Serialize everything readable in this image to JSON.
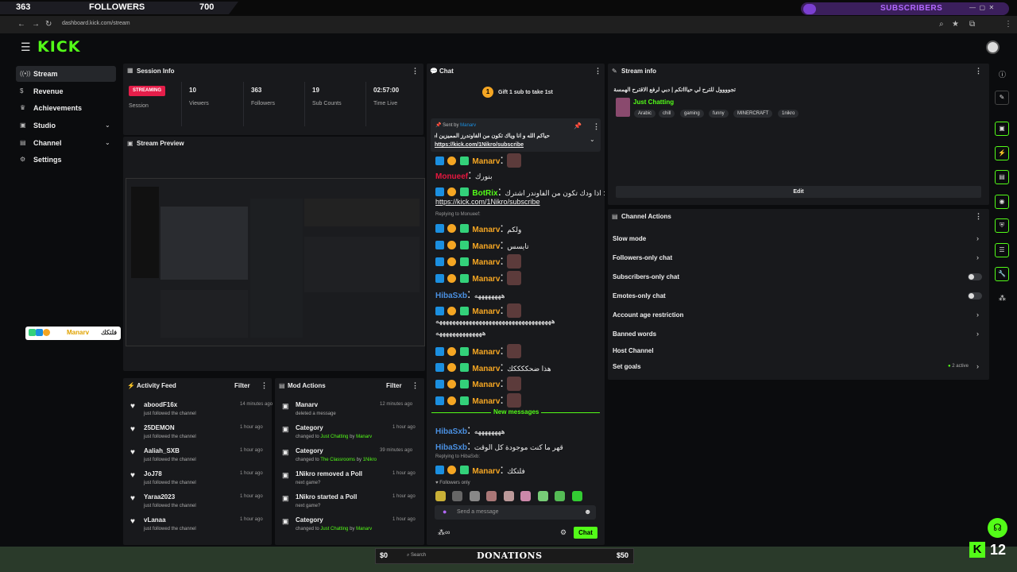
{
  "overlay": {
    "left_count": "363",
    "left_label": "FOLLOWERS",
    "left_goal": "700",
    "right_label": "SUBSCRIBERS"
  },
  "browser": {
    "url": "dashboard.kick.com/stream"
  },
  "header": {
    "logo": "KICK"
  },
  "sidebar": {
    "items": [
      {
        "label": "Stream"
      },
      {
        "label": "Revenue"
      },
      {
        "label": "Achievements"
      },
      {
        "label": "Studio"
      },
      {
        "label": "Channel"
      },
      {
        "label": "Settings"
      }
    ]
  },
  "session": {
    "title": "Session Info",
    "status": "STREAMING",
    "status_label": "Session",
    "stats": [
      {
        "value": "10",
        "label": "Viewers"
      },
      {
        "value": "363",
        "label": "Followers"
      },
      {
        "value": "19",
        "label": "Sub Counts"
      },
      {
        "value": "02:57:00",
        "label": "Time Live"
      }
    ]
  },
  "preview": {
    "title": "Stream Preview"
  },
  "activity": {
    "title": "Activity Feed",
    "filter": "Filter",
    "items": [
      {
        "name": "aboodF16x",
        "sub": "just followed the channel",
        "time": "14 minutes ago"
      },
      {
        "name": "25DEMON",
        "sub": "just followed the channel",
        "time": "1 hour ago"
      },
      {
        "name": "Aaliah_SXB",
        "sub": "just followed the channel",
        "time": "1 hour ago"
      },
      {
        "name": "JoJ78",
        "sub": "just followed the channel",
        "time": "1 hour ago"
      },
      {
        "name": "Yaraa2023",
        "sub": "just followed the channel",
        "time": "1 hour ago"
      },
      {
        "name": "vLanaa",
        "sub": "just followed the channel",
        "time": "1 hour ago"
      }
    ]
  },
  "mod": {
    "title": "Mod Actions",
    "filter": "Filter",
    "items": [
      {
        "name": "Manarv",
        "sub_pre": "deleted a message",
        "sub_hl": "",
        "sub_by": "",
        "sub_user": "",
        "time": "12 minutes ago"
      },
      {
        "name": "Category",
        "sub_pre": "changed to",
        "sub_hl": "Just Chatting",
        "sub_by": "by",
        "sub_user": "Manarv",
        "time": "1 hour ago"
      },
      {
        "name": "Category",
        "sub_pre": "changed to",
        "sub_hl": "The Classrooms",
        "sub_by": "by",
        "sub_user": "1Nikro",
        "time": "39 minutes ago"
      },
      {
        "name": "1Nikro removed a Poll",
        "sub_pre": "next game?",
        "sub_hl": "",
        "sub_by": "",
        "sub_user": "",
        "time": "1 hour ago"
      },
      {
        "name": "1Nikro started a Poll",
        "sub_pre": "next game?",
        "sub_hl": "",
        "sub_by": "",
        "sub_user": "",
        "time": "1 hour ago"
      },
      {
        "name": "Category",
        "sub_pre": "changed to",
        "sub_hl": "Just Chatting",
        "sub_by": "by",
        "sub_user": "Manarv",
        "time": "1 hour ago"
      }
    ]
  },
  "chat": {
    "title": "Chat",
    "gift_text": "Gift 1 sub to take 1st",
    "pinned_sender": "Sent by",
    "pinned_user": "Manarv",
    "pinned_text": "حياكم الله و انا وياك تكون من الفاوندرز المميزين اشتراكك",
    "pinned_link": "https://kick.com/1Nikro/subscribe",
    "messages": [
      {
        "user": "Manarv",
        "text": ""
      },
      {
        "user": "Monueef",
        "text": "بنورك"
      },
      {
        "user": "BotRix",
        "text": "اذا ودك تكون من الفاوندر اشترك :"
      },
      {
        "user": "",
        "text": "https://kick.com/1Nikro/subscribe"
      },
      {
        "user": "",
        "text": "Replying to Monueef:"
      },
      {
        "user": "Manarv",
        "text": "ولكم"
      },
      {
        "user": "Manarv",
        "text": "تايسس"
      },
      {
        "user": "Manarv",
        "text": ""
      },
      {
        "user": "Manarv",
        "text": ""
      },
      {
        "user": "HibaSxb",
        "text": "ههههههههه"
      },
      {
        "user": "Manarv",
        "text": ""
      },
      {
        "user": "",
        "text": "هههههههههههههههههههههههههههههههههههه"
      },
      {
        "user": "",
        "text": "ههههههههههههههه"
      },
      {
        "user": "Manarv",
        "text": ""
      },
      {
        "user": "Manarv",
        "text": "هذا ضحككككك"
      },
      {
        "user": "Manarv",
        "text": ""
      },
      {
        "user": "Manarv",
        "text": ""
      },
      {
        "user": "HibaSxb",
        "text": "ههههههههه"
      },
      {
        "user": "HibaSxb",
        "text": "قهر ما كنت موجودة كل الوقت"
      },
      {
        "user": "",
        "text": "Replying to HibaSxb:"
      },
      {
        "user": "Manarv",
        "text": "فلتكك"
      }
    ],
    "new_messages": "New messages",
    "followers_only": "Followers only",
    "input_placeholder": "Send a message",
    "send_label": "Chat"
  },
  "stream_info": {
    "title": "Stream info",
    "stream_title": "تجوووول للترح لي حياااتكم | دبي لرفع الاقترح الهمسة",
    "category": "Just Chatting",
    "tags": [
      "Arabic",
      "chill",
      "gaming",
      "funny",
      "MINERCRAFT",
      "1nikro"
    ],
    "edit_label": "Edit"
  },
  "channel_actions": {
    "title": "Channel Actions",
    "items": [
      {
        "label": "Slow mode"
      },
      {
        "label": "Followers-only chat"
      },
      {
        "label": "Subscribers-only chat"
      },
      {
        "label": "Emotes-only chat"
      },
      {
        "label": "Account age restriction"
      },
      {
        "label": "Banned words"
      },
      {
        "label": "Host Channel"
      },
      {
        "label": "Set goals"
      }
    ],
    "goals_active": "2 active"
  },
  "overlay_chat": {
    "user": "Manarv",
    "text": "فلتكك"
  },
  "taskbar": {
    "left_amount": "$0",
    "search": "Search",
    "donations": "DONATIONS",
    "right_amount": "$50",
    "kick_count": "12"
  },
  "colors": {
    "accent": "#53fc18",
    "live": "#e51e4a",
    "panel": "#18191c",
    "bg": "#0b0c0e"
  }
}
